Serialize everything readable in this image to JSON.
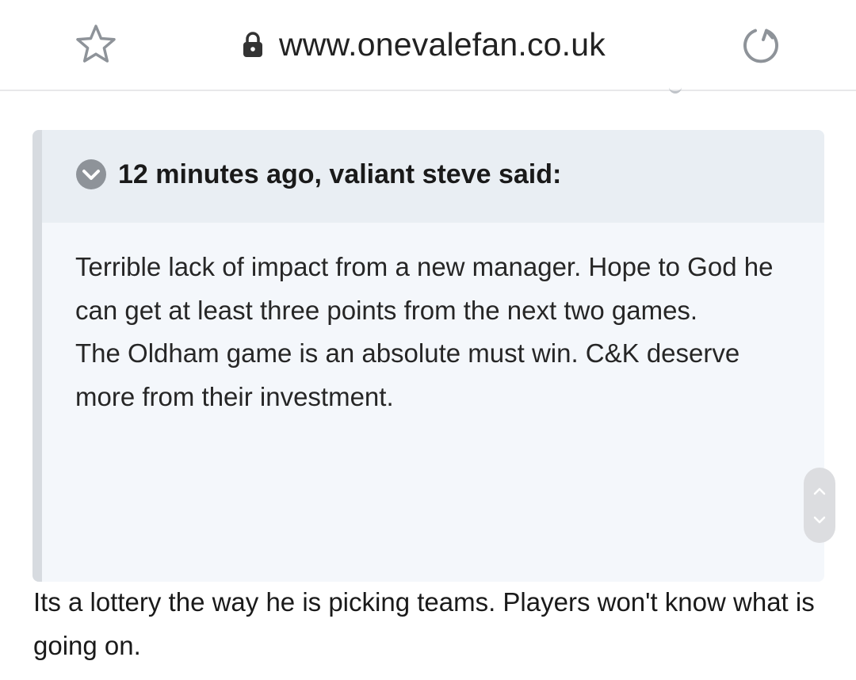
{
  "browser": {
    "url": "www.onevalefan.co.uk",
    "icons": {
      "favorite": "star-outline-icon",
      "secure": "lock-icon",
      "reload": "reload-icon"
    }
  },
  "quote": {
    "citation": "12 minutes ago, valiant steve said:",
    "paragraphs": [
      "Terrible lack of impact from a new manager. Hope to God he can get at least three points from the next two games.",
      "The Oldham game is an absolute must win. C&K deserve more from their investment."
    ],
    "icons": {
      "collapse": "chevron-down-circle-icon"
    }
  },
  "reply": {
    "text": "Its a lottery the way he is picking teams. Players won't know what is going on."
  },
  "scroll_nav": {
    "icons": {
      "up": "chevron-up-icon",
      "down": "chevron-down-icon"
    }
  },
  "colors": {
    "quote_background": "#f4f7fb",
    "quote_header_background": "#e9eef3",
    "quote_bar": "#d7dbe0",
    "icon_gray": "#8e9399"
  }
}
